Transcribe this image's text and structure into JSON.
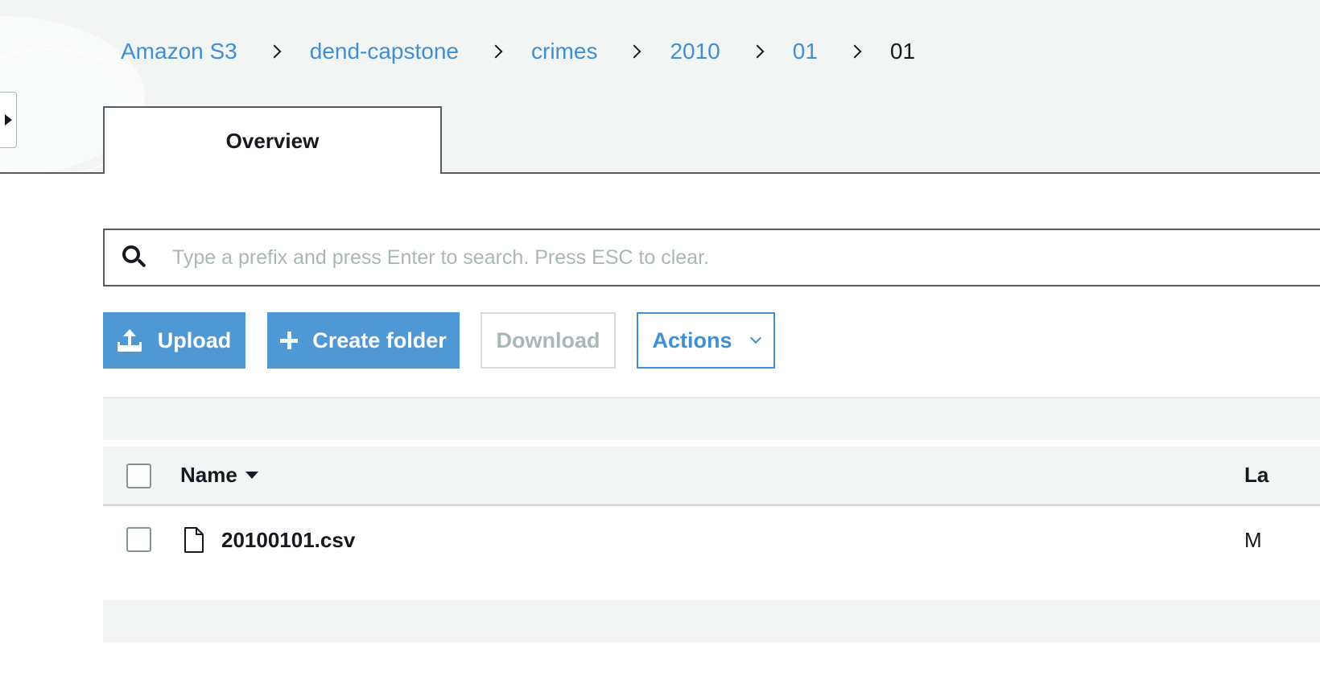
{
  "breadcrumb": {
    "items": [
      "Amazon S3",
      "dend-capstone",
      "crimes",
      "2010",
      "01"
    ],
    "current": "01"
  },
  "tabs": [
    {
      "label": "Overview",
      "active": true
    }
  ],
  "search": {
    "placeholder": "Type a prefix and press Enter to search. Press ESC to clear.",
    "value": ""
  },
  "toolbar": {
    "upload_label": "Upload",
    "create_folder_label": "Create folder",
    "download_label": "Download",
    "actions_label": "Actions"
  },
  "table": {
    "columns": [
      "Name",
      "La"
    ],
    "rows": [
      {
        "name": "20100101.csv",
        "last_modified": "M"
      }
    ]
  },
  "colors": {
    "accent": "#4f98d4",
    "link": "#3f8fd2",
    "text": "#16191f",
    "band": "#f3f5f5",
    "disabled": "#aab7b8"
  },
  "icons": [
    "sidebar-toggle-icon",
    "chevron-right-icon",
    "search-icon",
    "upload-icon",
    "plus-icon",
    "chevron-down-icon",
    "sort-down-icon",
    "file-icon"
  ]
}
